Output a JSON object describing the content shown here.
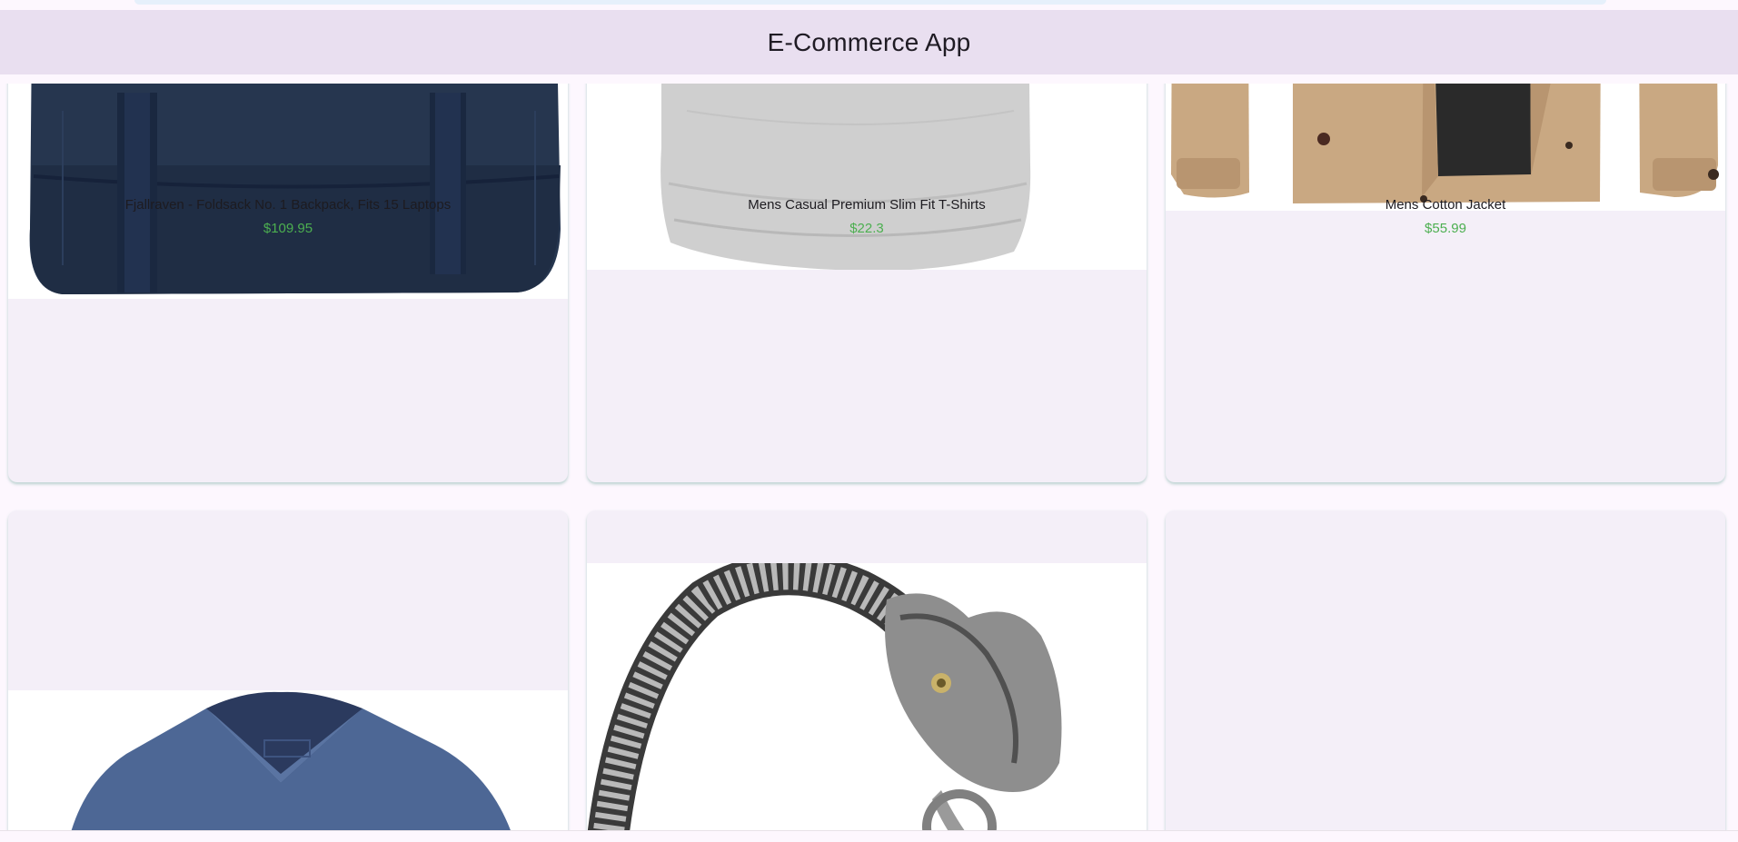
{
  "app": {
    "title": "E-Commerce App"
  },
  "products": [
    {
      "title": "Fjallraven - Foldsack No. 1 Backpack, Fits 15 Laptops",
      "price": "$109.95",
      "image": "backpack-image"
    },
    {
      "title": "Mens Casual Premium Slim Fit T-Shirts",
      "price": "$22.3",
      "image": "tshirt-image"
    },
    {
      "title": "Mens Cotton Jacket",
      "price": "$55.99",
      "image": "jacket-image"
    },
    {
      "title": "",
      "price": "",
      "image": "vneck-shirt-image"
    },
    {
      "title": "",
      "price": "",
      "image": "dragon-bracelet-image"
    },
    {
      "title": "",
      "price": "",
      "image": ""
    }
  ],
  "colors": {
    "appbar": "#e9dff0",
    "background": "#fdf7fe",
    "card": "#f4eff8",
    "price": "#4caf50"
  }
}
